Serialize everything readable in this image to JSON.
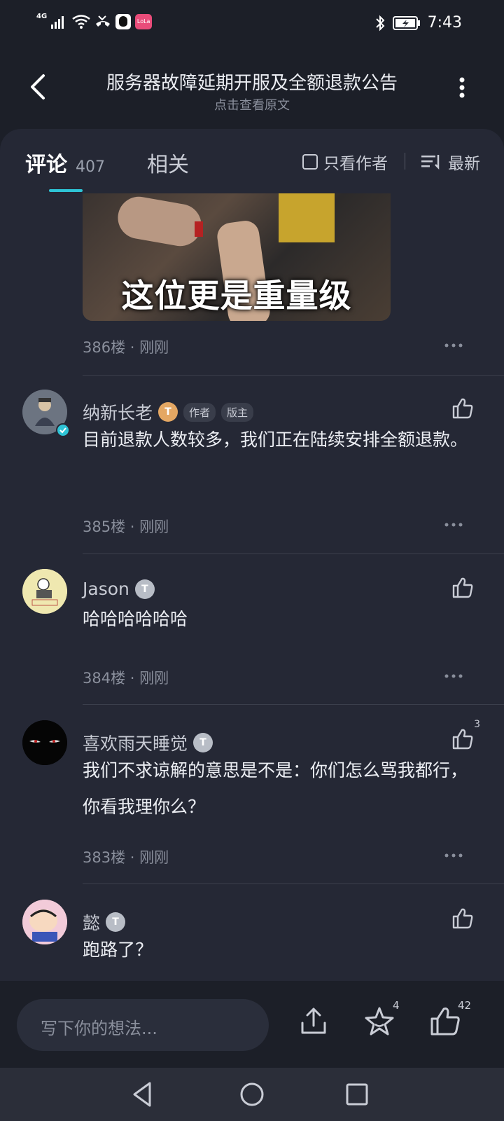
{
  "status_bar": {
    "network": "4G",
    "time": "7:43",
    "app_icon_text": "LoLa"
  },
  "header": {
    "title": "服务器故障延期开服及全额退款公告",
    "subtitle": "点击查看原文"
  },
  "tabs": {
    "comments_label": "评论",
    "comments_count": "407",
    "related_label": "相关",
    "author_only_label": "只看作者",
    "sort_label": "最新"
  },
  "meme": {
    "caption": "这位更是重量级",
    "meta": "386楼 · 刚刚"
  },
  "comments": [
    {
      "username": "纳新长老",
      "level_badge": "T",
      "tags": [
        "作者",
        "版主"
      ],
      "text": "目前退款人数较多，我们正在陆续安排全额退款。",
      "meta": "385楼 · 刚刚",
      "likes": ""
    },
    {
      "username": "Jason",
      "level_badge": "T",
      "tags": [],
      "text": "哈哈哈哈哈哈",
      "meta": "384楼 · 刚刚",
      "likes": ""
    },
    {
      "username": "喜欢雨天睡觉",
      "level_badge": "T",
      "tags": [],
      "text": "我们不求谅解的意思是不是：你们怎么骂我都行，你看我理你么？",
      "meta": "383楼 · 刚刚",
      "likes": "3"
    },
    {
      "username": "懿",
      "level_badge": "T",
      "tags": [],
      "text": "跑路了？",
      "meta": "",
      "likes": ""
    }
  ],
  "bottom_bar": {
    "input_placeholder": "写下你的想法...",
    "favorite_count": "4",
    "like_count": "42"
  },
  "colors": {
    "accent": "#2ec4d6",
    "background": "#1c1f28",
    "card": "#252835"
  }
}
